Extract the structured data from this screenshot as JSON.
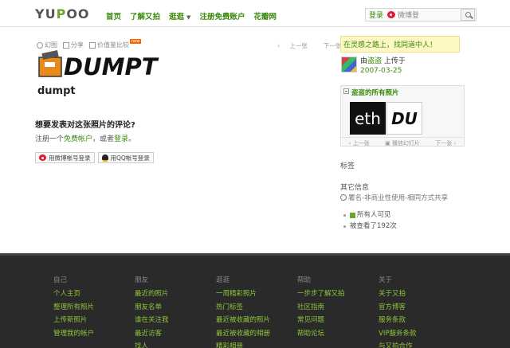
{
  "header": {
    "logo": "YUPOO",
    "nav": [
      {
        "label": "首页"
      },
      {
        "label": "了解又拍"
      },
      {
        "label": "逛逛"
      },
      {
        "label": "注册免费账户"
      },
      {
        "label": "花瓣网"
      }
    ],
    "login_label": "登录",
    "weibo_login_label": "微博登"
  },
  "toolbar": {
    "items": [
      {
        "label": "幻图"
      },
      {
        "label": "分享"
      },
      {
        "label": "价值鉴比较"
      }
    ],
    "new_badge": "new",
    "prev_label": "上一张",
    "next_label": "下一张"
  },
  "photo": {
    "image_text": "DUMPT",
    "title": "dumpt"
  },
  "comment": {
    "heading": "想要发表对这张照片的评论?",
    "text_before": "注册一个",
    "register_link": "免费帐户",
    "text_mid": "，或者",
    "login_link": "登录",
    "text_after": "。",
    "weibo_button": "用微博帐号登录",
    "qq_button": "用QQ帐号登录"
  },
  "sidebar": {
    "promo": "在灵感之路上，找同道中人！",
    "uploaded_by_prefix": "由",
    "uploader_name": "盗盗",
    "uploaded_by_suffix": "上传于",
    "upload_date": "2007-03-25",
    "all_photos_title": "盗盗的所有照片",
    "thumbs": [
      "eth",
      "DU"
    ],
    "thumb_prev": "上一张",
    "thumb_slideshow": "播放幻灯片",
    "thumb_next": "下一张",
    "tags_label": "标签",
    "other_info_label": "其它信息",
    "license": "署名-非商业性使用-相同方式共享",
    "visibility": "所有人可见",
    "view_count": "被查看了192次"
  },
  "footer": {
    "columns": [
      {
        "heading": "自己",
        "links": [
          "个人主页",
          "整理所有照片",
          "上传新照片",
          "管理我的帐户"
        ]
      },
      {
        "heading": "朋友",
        "links": [
          "最近的照片",
          "朋友名单",
          "谁在关注我",
          "最近访客",
          "找人"
        ]
      },
      {
        "heading": "逛逛",
        "links": [
          "一周精彩照片",
          "热门标签",
          "最近被收藏的照片",
          "最近被收藏的相册",
          "精彩相册"
        ]
      },
      {
        "heading": "帮助",
        "links": [
          "一步步了解又拍",
          "社区指南",
          "常见问题",
          "帮助论坛"
        ]
      },
      {
        "heading": "关于",
        "links": [
          "关于又拍",
          "官方博客",
          "服务条款",
          "VIP服务条款",
          "与又拍合作"
        ]
      }
    ]
  },
  "colors": {
    "accent_green": "#3a8a0c",
    "footer_bg": "#2a2a2a",
    "footer_link": "#8fc43a"
  }
}
